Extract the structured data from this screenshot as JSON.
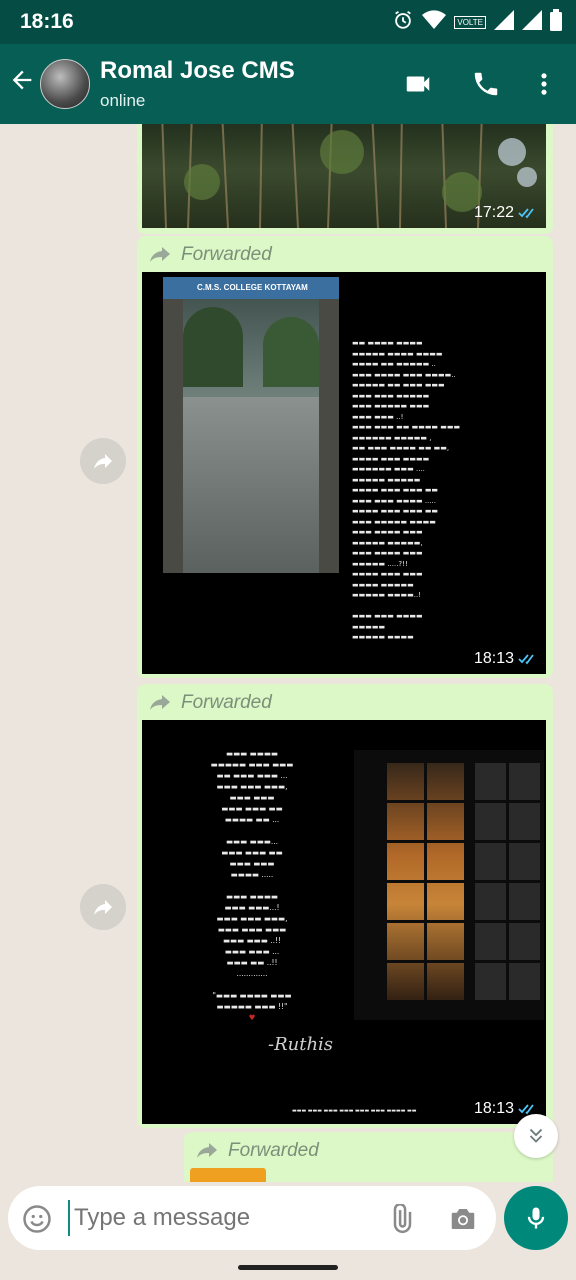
{
  "status_bar": {
    "time": "18:16",
    "volte": "VOLTE"
  },
  "header": {
    "contact_name": "Romal Jose CMS",
    "status": "online"
  },
  "messages": [
    {
      "timestamp": "17:22"
    },
    {
      "forwarded_label": "Forwarded",
      "timestamp": "18:13",
      "image_caption": "C.M.S. COLLEGE KOTTAYAM"
    },
    {
      "forwarded_label": "Forwarded",
      "timestamp": "18:13",
      "signature": "-Ruthis"
    },
    {
      "forwarded_label": "Forwarded"
    }
  ],
  "input": {
    "placeholder": "Type a message"
  },
  "colors": {
    "header": "#075e54",
    "status_bar": "#054d44",
    "bubble": "#dcf8c6",
    "accent": "#00897b",
    "chat_bg": "#ece5dd"
  },
  "icons": [
    "back-arrow-icon",
    "video-call-icon",
    "phone-icon",
    "more-vert-icon",
    "share-forward-icon",
    "double-check-icon",
    "chevron-double-down-icon",
    "emoji-icon",
    "attach-icon",
    "camera-icon",
    "mic-icon"
  ]
}
